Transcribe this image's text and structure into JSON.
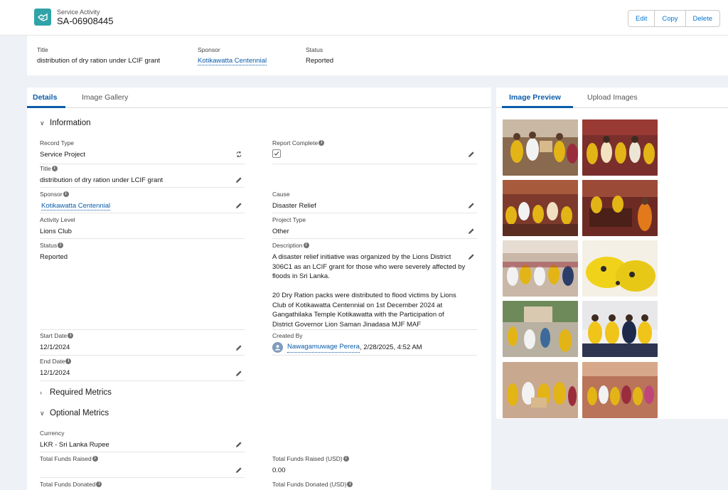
{
  "header": {
    "object_type": "Service Activity",
    "record_name": "SA-06908445",
    "buttons": {
      "edit": "Edit",
      "copy": "Copy",
      "delete": "Delete"
    }
  },
  "highlights": {
    "title_label": "Title",
    "title_value": "distribution of dry ration under LCIF grant",
    "sponsor_label": "Sponsor",
    "sponsor_value": "Kotikawatta Centennial",
    "status_label": "Status",
    "status_value": "Reported"
  },
  "tabs": {
    "details": "Details",
    "image_gallery": "Image Gallery"
  },
  "right_tabs": {
    "image_preview": "Image Preview",
    "upload_images": "Upload Images"
  },
  "sections": {
    "information": "Information",
    "required_metrics": "Required Metrics",
    "optional_metrics": "Optional Metrics"
  },
  "fields": {
    "record_type": {
      "label": "Record Type",
      "value": "Service Project"
    },
    "report_complete": {
      "label": "Report Complete",
      "checked": true
    },
    "title": {
      "label": "Title",
      "value": "distribution of dry ration under LCIF grant"
    },
    "sponsor": {
      "label": "Sponsor",
      "value": "Kotikawatta Centennial"
    },
    "cause": {
      "label": "Cause",
      "value": "Disaster Relief"
    },
    "activity_level": {
      "label": "Activity Level",
      "value": "Lions Club"
    },
    "project_type": {
      "label": "Project Type",
      "value": "Other"
    },
    "status": {
      "label": "Status",
      "value": "Reported"
    },
    "description": {
      "label": "Description",
      "line1": "A disaster relief initiative was organized by the Lions District",
      "line2": "306C1 as an LCIF grant for those who were severely affected by",
      "line3": "floods in Sri Lanka.",
      "line4": "20 Dry Ration packs were distributed to flood victims by Lions",
      "line5": "Club of Kotikawatta Centennial on 1st December 2024 at",
      "line6": "Gangathilaka Temple Kotikawatta with the Participation of",
      "line7": "District Governor Lion Saman Jinadasa MJF MAF"
    },
    "start_date": {
      "label": "Start Date",
      "value": "12/1/2024"
    },
    "created_by": {
      "label": "Created By",
      "user": "Nawagamuwage Perera",
      "timestamp": ", 2/28/2025, 4:52 AM"
    },
    "end_date": {
      "label": "End Date",
      "value": "12/1/2024"
    },
    "currency": {
      "label": "Currency",
      "value": "LKR - Sri Lanka Rupee"
    },
    "total_funds_raised": {
      "label": "Total Funds Raised",
      "value": ""
    },
    "total_funds_raised_usd": {
      "label": "Total Funds Raised (USD)",
      "value": "0.00"
    },
    "total_funds_donated": {
      "label": "Total Funds Donated"
    },
    "total_funds_donated_usd": {
      "label": "Total Funds Donated (USD)"
    }
  },
  "colors": {
    "brand_icon": "#2fa3a8",
    "link": "#0b5cab",
    "tab_active": "#0b5cab"
  },
  "images": [
    "photo-1",
    "photo-2",
    "photo-3",
    "photo-4",
    "photo-5",
    "photo-6",
    "photo-7",
    "photo-8",
    "photo-9",
    "photo-10"
  ]
}
